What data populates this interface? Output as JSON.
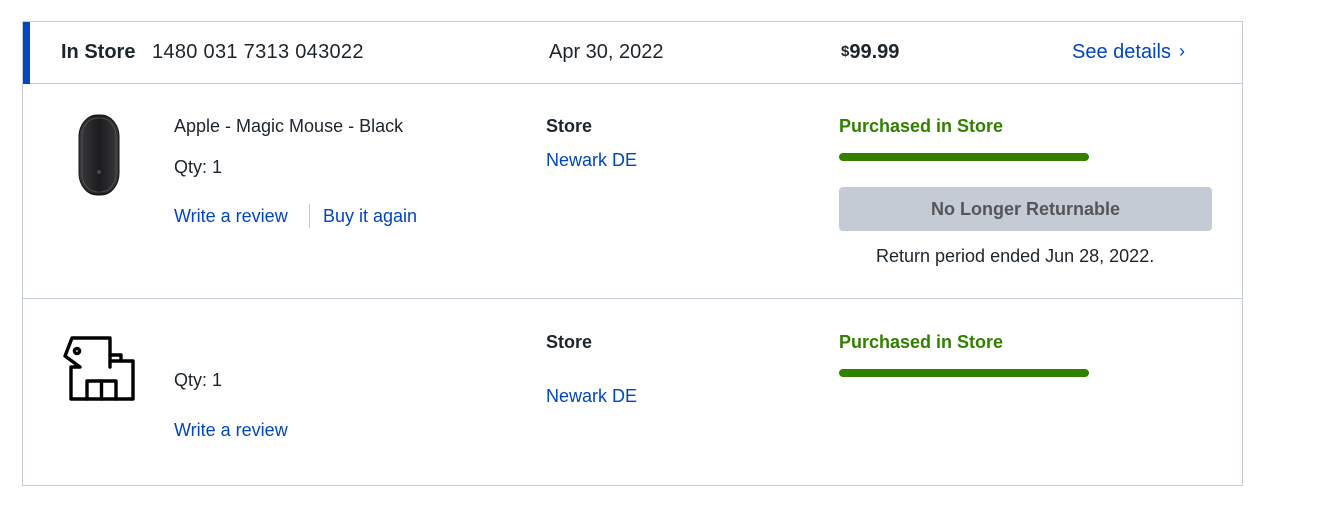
{
  "order": {
    "type": "In Store",
    "number": "1480 031 7313 043022",
    "date": "Apr 30, 2022",
    "price_currency": "$",
    "price_amount": "99.99",
    "details_link": "See details",
    "details_chevron": "›"
  },
  "items": [
    {
      "name": "Apple - Magic Mouse - Black",
      "qty": "Qty: 1",
      "write_review": "Write a review",
      "buy_again": "Buy it again",
      "store_label": "Store",
      "store_location": "Newark DE",
      "status": "Purchased in Store",
      "progress": 1.0,
      "return_button": "No Longer Returnable",
      "return_note": "Return period ended Jun 28, 2022."
    },
    {
      "qty": "Qty: 1",
      "write_review": "Write a review",
      "store_label": "Store",
      "store_location": "Newark DE",
      "status": "Purchased in Store",
      "progress": 1.0
    }
  ],
  "colors": {
    "accent": "#0046be",
    "status_green": "#318000",
    "border": "#c5cbd5"
  },
  "icons": {
    "item1": "magic-mouse-product-image",
    "item2": "store-tag-placeholder-icon"
  }
}
